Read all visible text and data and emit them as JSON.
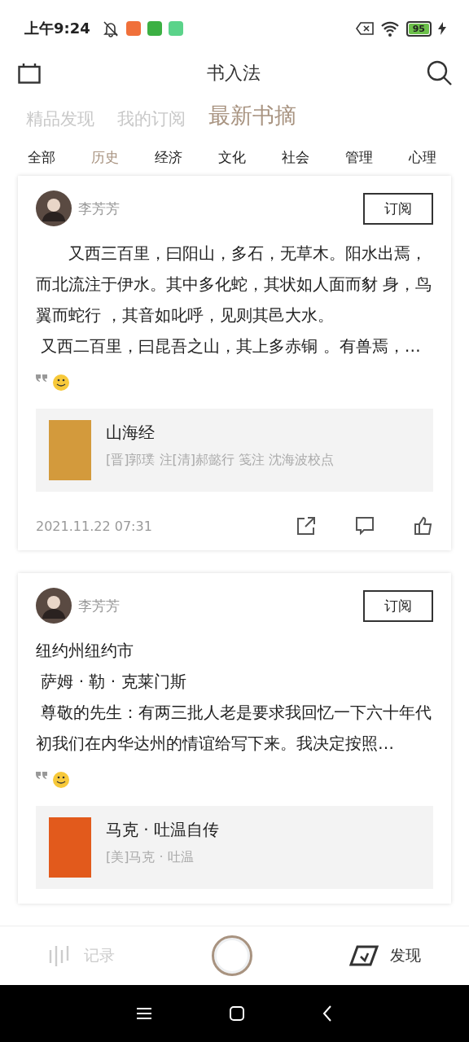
{
  "status_bar": {
    "time": "上午9:24",
    "app_icons": [
      {
        "color": "#f0703a"
      },
      {
        "color": "#3cb043"
      },
      {
        "color": "#5bd38a"
      }
    ],
    "battery": "95"
  },
  "header": {
    "title": "书入法"
  },
  "tabs": [
    {
      "label": "精品发现",
      "selected": false
    },
    {
      "label": "我的订阅",
      "selected": false
    },
    {
      "label": "最新书摘",
      "selected": true
    }
  ],
  "categories": [
    {
      "label": "全部",
      "selected": false
    },
    {
      "label": "历史",
      "selected": true
    },
    {
      "label": "经济",
      "selected": false
    },
    {
      "label": "文化",
      "selected": false
    },
    {
      "label": "社会",
      "selected": false
    },
    {
      "label": "管理",
      "selected": false
    },
    {
      "label": "心理",
      "selected": false
    }
  ],
  "posts": [
    {
      "author": "李芳芳",
      "subscribe": "订阅",
      "paragraphs": [
        "　　又西三百里，曰阳山，多石，无草木。阳水出焉，而北流注于伊水。其中多化蛇，其状如人面而豺 身，鸟翼而蛇行 ，其音如叱呼，见则其邑大水。",
        " 又西二百里，曰昆吾之山，其上多赤铜 。有兽焉，…"
      ],
      "book": {
        "title": "山海经",
        "author": "[晋]郭璞 注[清]郝懿行 笺注 沈海波校点",
        "color": "#d39a3c"
      },
      "date": "2021.11.22 07:31"
    },
    {
      "author": "李芳芳",
      "subscribe": "订阅",
      "paragraphs": [
        "纽约州纽约市",
        " 萨姆 · 勒 · 克莱门斯",
        " 尊敬的先生：有两三批人老是要求我回忆一下六十年代初我们在内华达州的情谊给写下来。我决定按照…"
      ],
      "book": {
        "title": "马克 · 吐温自传",
        "author": "[美]马克 · 吐温",
        "color": "#e25a1c"
      }
    }
  ],
  "bottom_nav": [
    {
      "label": "记录",
      "selected": false
    },
    {
      "label": "发现",
      "selected": true
    }
  ]
}
